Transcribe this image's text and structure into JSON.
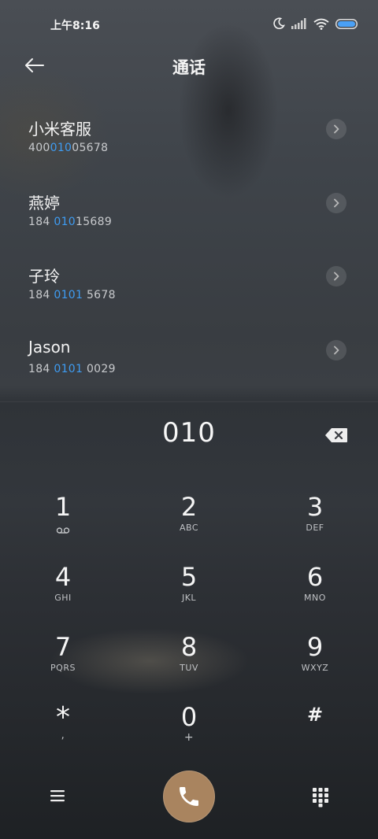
{
  "status_bar": {
    "time": "上午8:16",
    "icons": [
      "moon-icon",
      "signal-icon",
      "wifi-icon",
      "battery-icon"
    ]
  },
  "header": {
    "title": "通话",
    "back_icon": "back-arrow-icon"
  },
  "search_results": [
    {
      "name": "小米客服",
      "number_parts": [
        "400",
        "010",
        "05678"
      ]
    },
    {
      "name": "燕婷",
      "number_parts": [
        "184 ",
        "010",
        "15689"
      ]
    },
    {
      "name": "子玲",
      "number_parts": [
        "184 ",
        "0101",
        " 5678"
      ]
    },
    {
      "name": "Jason",
      "number_parts": [
        "184 ",
        "0101",
        " 0029"
      ]
    }
  ],
  "dialer": {
    "input_value": "010",
    "backspace_icon": "backspace-icon"
  },
  "keypad": [
    {
      "digit": "1",
      "sub": "",
      "sub_icon": "voicemail-icon"
    },
    {
      "digit": "2",
      "sub": "ABC"
    },
    {
      "digit": "3",
      "sub": "DEF"
    },
    {
      "digit": "4",
      "sub": "GHI"
    },
    {
      "digit": "5",
      "sub": "JKL"
    },
    {
      "digit": "6",
      "sub": "MNO"
    },
    {
      "digit": "7",
      "sub": "PQRS"
    },
    {
      "digit": "8",
      "sub": "TUV"
    },
    {
      "digit": "9",
      "sub": "WXYZ"
    },
    {
      "digit": "*",
      "sub": ","
    },
    {
      "digit": "0",
      "sub": "+"
    },
    {
      "digit": "#",
      "sub": ""
    }
  ],
  "bottom_bar": {
    "menu_icon": "menu-icon",
    "call_icon": "phone-icon",
    "keypad_icon": "dialpad-icon"
  },
  "colors": {
    "highlight": "#3e9cf2",
    "call_button": "#a9845f"
  }
}
